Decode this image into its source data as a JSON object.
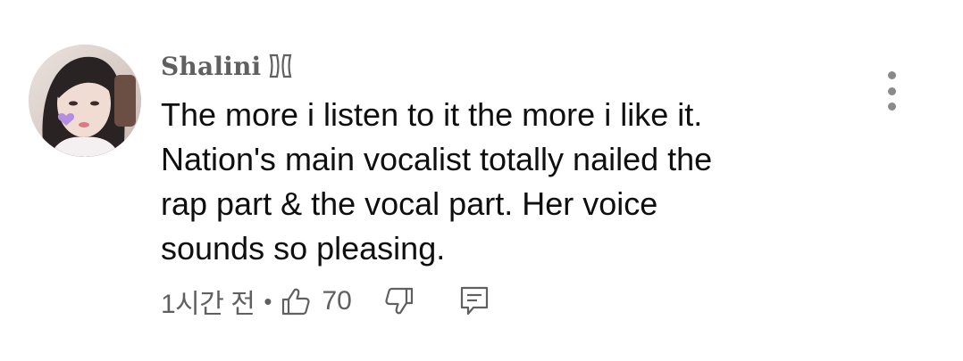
{
  "comment": {
    "author": "Shalini",
    "badge_icon": "member-badge-icon",
    "text": "The more i listen to it the more i like it.\nNation's main vocalist totally nailed the\nrap part & the vocal part. Her voice\nsounds so pleasing.",
    "timestamp": "1시간 전",
    "separator": "•",
    "like_count": "70"
  },
  "icons": {
    "like": "thumbs-up-icon",
    "dislike": "thumbs-down-icon",
    "reply": "reply-comment-icon",
    "menu": "more-vert-icon"
  },
  "colors": {
    "text_primary": "#0f0f0f",
    "text_secondary": "#606060",
    "menu_dots": "#8a8a8a",
    "background": "#ffffff"
  }
}
